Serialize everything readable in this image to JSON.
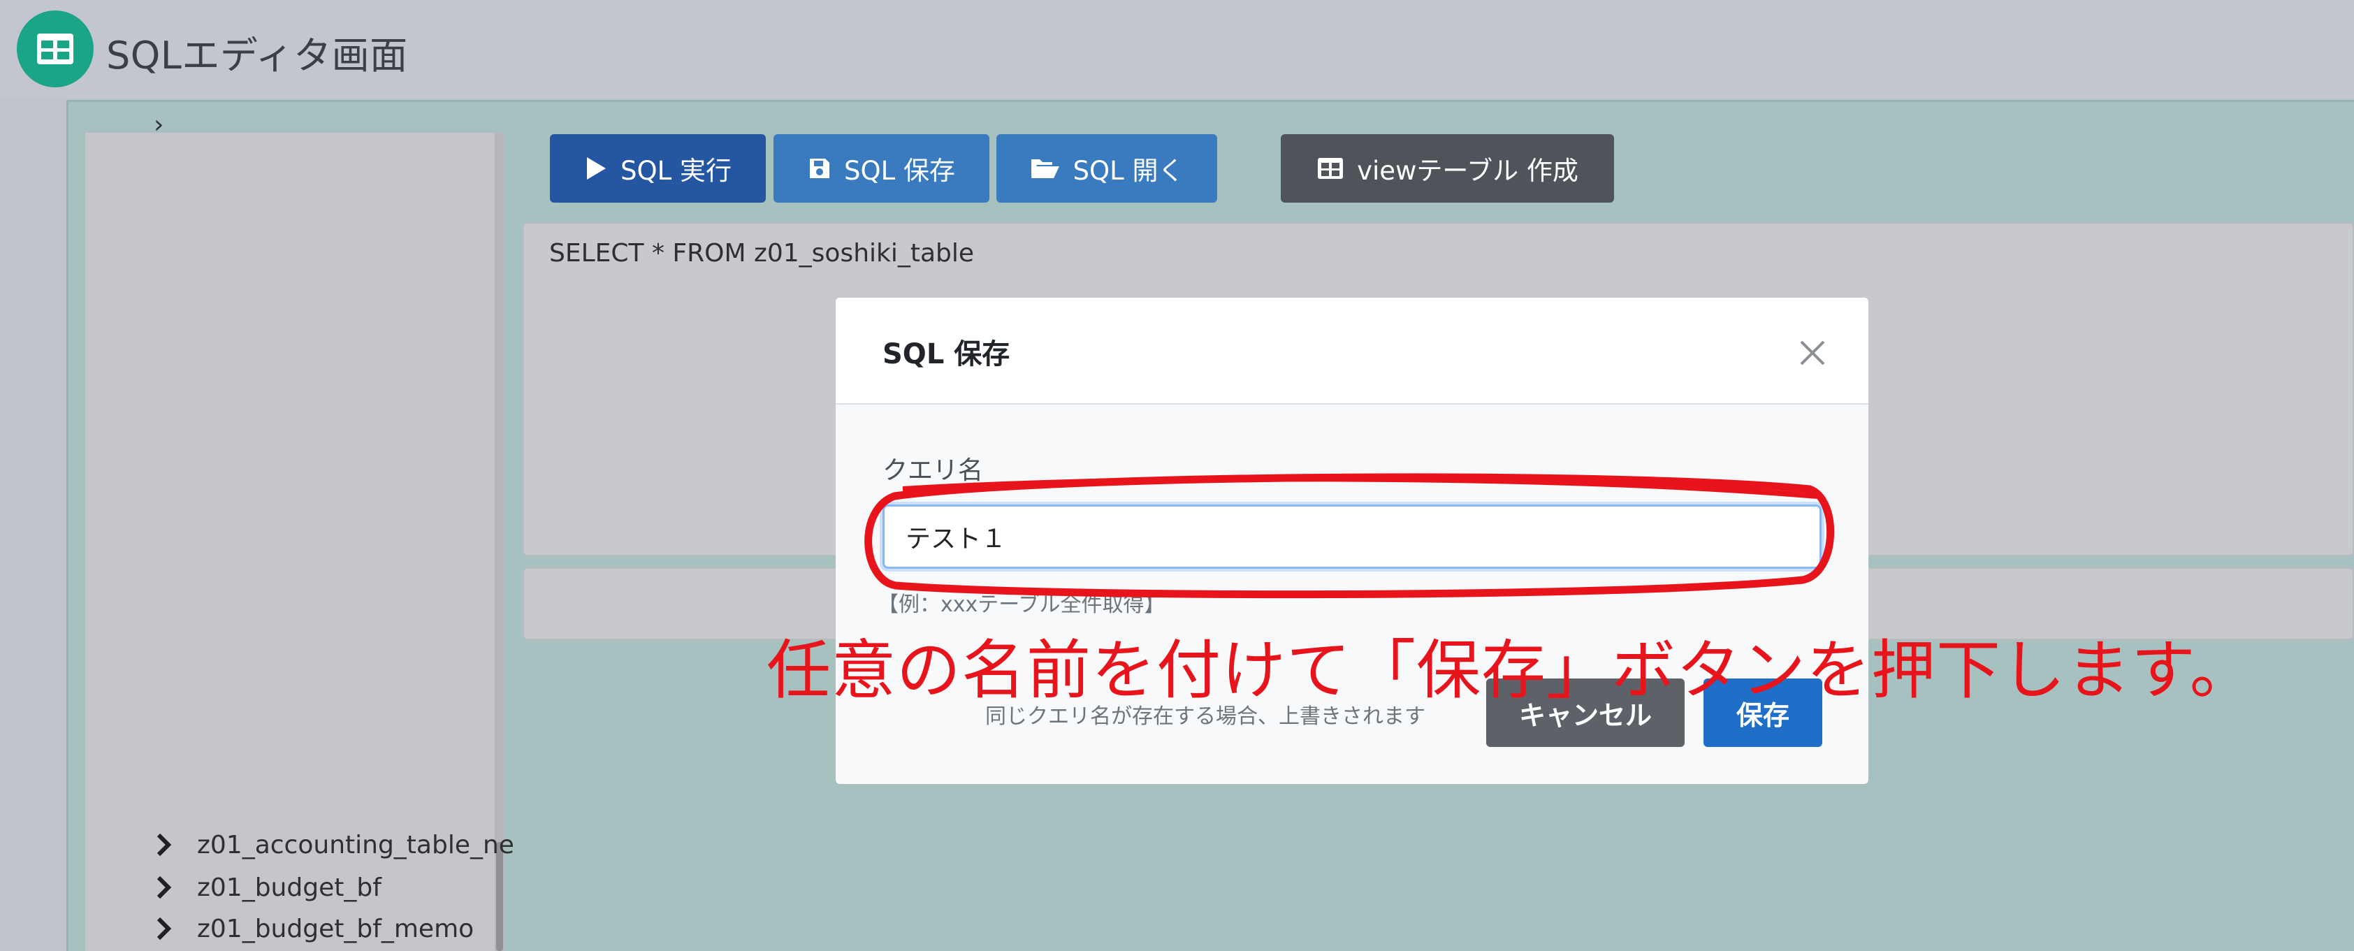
{
  "app": {
    "title": "SQLエディタ画面",
    "icon": "table-grid-icon",
    "accent": "#1aa586"
  },
  "toolbar": {
    "run_label": "SQL 実行",
    "save_label": "SQL 保存",
    "open_label": "SQL 開く",
    "view_label": "viewテーブル 作成"
  },
  "editor": {
    "sql": "SELECT * FROM z01_soshiki_table"
  },
  "sidebar": {
    "items": [
      {
        "label": "z01_accounting_table_ne"
      },
      {
        "label": "z01_budget_bf"
      },
      {
        "label": "z01_budget_bf_memo"
      }
    ]
  },
  "modal": {
    "title": "SQL 保存",
    "query_label": "クエリ名",
    "query_value": "テスト１",
    "example": "【例：xxxテーブル全件取得】",
    "overwrite_note": "同じクエリ名が存在する場合、上書きされます",
    "cancel_label": "キャンセル",
    "save_label": "保存"
  },
  "annotation": {
    "text": "任意の名前を付けて「保存」ボタンを押下します。",
    "color": "#e8141c"
  }
}
